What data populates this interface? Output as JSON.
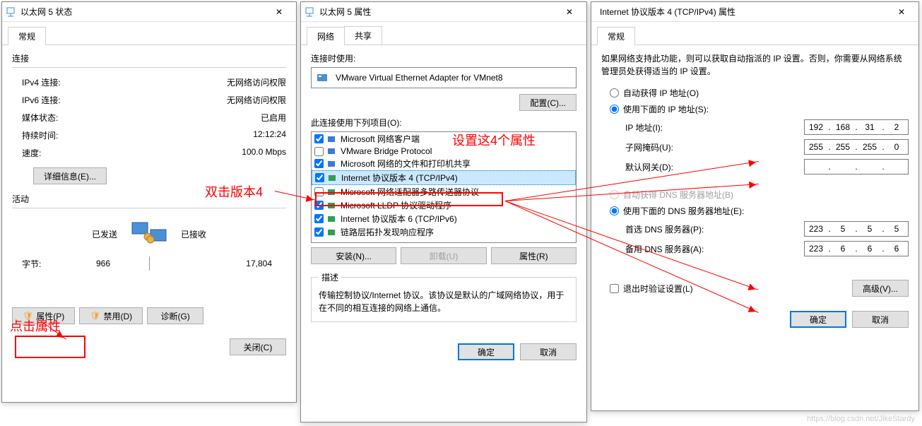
{
  "annotations": {
    "click_props": "点击属性",
    "dbl_v4": "双击版本4",
    "set4": "设置这4个属性"
  },
  "dlg1": {
    "title": "以太网 5 状态",
    "tab": "常规",
    "sec1": "连接",
    "ipv4": {
      "l": "IPv4 连接:",
      "v": "无网络访问权限"
    },
    "ipv6": {
      "l": "IPv6 连接:",
      "v": "无网络访问权限"
    },
    "media": {
      "l": "媒体状态:",
      "v": "已启用"
    },
    "dur": {
      "l": "持续时间:",
      "v": "12:12:24"
    },
    "speed": {
      "l": "速度:",
      "v": "100.0 Mbps"
    },
    "details": "详细信息(E)...",
    "sec2": "活动",
    "sent": "已发送",
    "recv": "已接收",
    "bytes_l": "字节:",
    "bytes_s": "966",
    "bytes_r": "17,804",
    "props": "属性(P)",
    "disable": "禁用(D)",
    "diag": "诊断(G)",
    "close": "关闭(C)"
  },
  "dlg2": {
    "title": "以太网 5 属性",
    "tabs": [
      "网络",
      "共享"
    ],
    "conn_using": "连接时使用:",
    "adapter": "VMware Virtual Ethernet Adapter for VMnet8",
    "config": "配置(C)...",
    "items_label": "此连接使用下列项目(O):",
    "items": [
      {
        "c": true,
        "t": "Microsoft 网络客户端",
        "color": "#3a7bd5"
      },
      {
        "c": false,
        "t": "VMware Bridge Protocol",
        "color": "#3a7bd5"
      },
      {
        "c": true,
        "t": "Microsoft 网络的文件和打印机共享",
        "color": "#3a7bd5"
      },
      {
        "c": true,
        "t": "Internet 协议版本 4 (TCP/IPv4)",
        "color": "#2e9e5b",
        "hi": true
      },
      {
        "c": false,
        "t": "Microsoft 网络适配器多路传送器协议",
        "color": "#2e9e5b"
      },
      {
        "c": true,
        "t": "Microsoft LLDP 协议驱动程序",
        "color": "#2e9e5b"
      },
      {
        "c": true,
        "t": "Internet 协议版本 6 (TCP/IPv6)",
        "color": "#2e9e5b"
      },
      {
        "c": true,
        "t": "链路层拓扑发现响应程序",
        "color": "#2e9e5b"
      }
    ],
    "install": "安装(N)...",
    "uninstall": "卸载(U)",
    "props": "属性(R)",
    "desc_l": "描述",
    "desc": "传输控制协议/Internet 协议。该协议是默认的广域网络协议，用于在不同的相互连接的网络上通信。",
    "ok": "确定",
    "cancel": "取消"
  },
  "dlg3": {
    "title": "Internet 协议版本 4 (TCP/IPv4) 属性",
    "tab": "常规",
    "info": "如果网络支持此功能，则可以获取自动指派的 IP 设置。否则，你需要从网络系统管理员处获得适当的 IP 设置。",
    "r_auto_ip": "自动获得 IP 地址(O)",
    "r_man_ip": "使用下面的 IP 地址(S):",
    "ip_l": "IP 地址(I):",
    "ip": [
      "192",
      "168",
      "31",
      "2"
    ],
    "mask_l": "子网掩码(U):",
    "mask": [
      "255",
      "255",
      "255",
      "0"
    ],
    "gw_l": "默认网关(D):",
    "gw": [
      "",
      "",
      "",
      ""
    ],
    "r_auto_dns": "自动获得 DNS 服务器地址(B)",
    "r_man_dns": "使用下面的 DNS 服务器地址(E):",
    "dns1_l": "首选 DNS 服务器(P):",
    "dns1": [
      "223",
      "5",
      "5",
      "5"
    ],
    "dns2_l": "备用 DNS 服务器(A):",
    "dns2": [
      "223",
      "6",
      "6",
      "6"
    ],
    "cb_exit": "退出时验证设置(L)",
    "adv": "高级(V)...",
    "ok": "确定",
    "cancel": "取消"
  },
  "watermark": "https://blog.csdn.net/JikeStardy"
}
